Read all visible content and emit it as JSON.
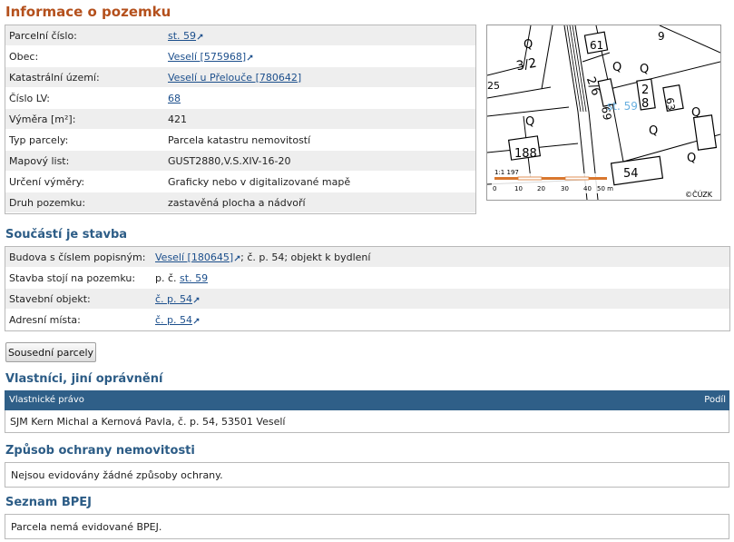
{
  "title": "Informace o pozemku",
  "parcel": [
    {
      "label": "Parcelní číslo:",
      "value": "st. 59",
      "link": true,
      "ext": true
    },
    {
      "label": "Obec:",
      "value": "Veselí [575968]",
      "link": true,
      "ext": true
    },
    {
      "label": "Katastrální území:",
      "value": "Veselí u Přelouče [780642]",
      "link": true,
      "ext": false
    },
    {
      "label": "Číslo LV:",
      "value": "68",
      "link": true,
      "ext": false
    },
    {
      "label": "Výměra [m²]:",
      "value": "421",
      "link": false,
      "ext": false
    },
    {
      "label": "Typ parcely:",
      "value": "Parcela katastru nemovitostí",
      "link": false,
      "ext": false
    },
    {
      "label": "Mapový list:",
      "value": "GUST2880,V.S.XIV-16-20",
      "link": false,
      "ext": false
    },
    {
      "label": "Určení výměry:",
      "value": "Graficky nebo v digitalizované mapě",
      "link": false,
      "ext": false
    },
    {
      "label": "Druh pozemku:",
      "value": "zastavěná plocha a nádvoří",
      "link": false,
      "ext": false
    }
  ],
  "map": {
    "parcel_label": "st. 59",
    "scale_text": "1:1 197",
    "scale_ticks": [
      "0",
      "10",
      "20",
      "30",
      "40",
      "50 m"
    ],
    "copyright": "©ČÚZK",
    "numbers": [
      "61",
      "3/2",
      "25",
      "2/6",
      "69",
      "2",
      "8",
      "63",
      "9",
      "188",
      "54"
    ]
  },
  "building": {
    "title": "Součástí je stavba",
    "row1": {
      "label": "Budova s číslem popisným:",
      "link": "Veselí [180645]",
      "suffix": "; č. p. 54; objekt k bydlení"
    },
    "row2": {
      "label": "Stavba stojí na pozemku:",
      "prefix": "p. č.",
      "link": "st. 59"
    },
    "row3": {
      "label": "Stavební objekt:",
      "link": "č. p. 54"
    },
    "row4": {
      "label": "Adresní místa:",
      "link": "č. p. 54"
    }
  },
  "neighbors_button": "Sousední parcely",
  "owners": {
    "title": "Vlastníci, jiní oprávnění",
    "col_right": "Vlastnické právo",
    "col_share": "Podíl",
    "row": "SJM Kern Michal a Kernová Pavla, č. p. 54, 53501 Veselí"
  },
  "protection": {
    "title": "Způsob ochrany nemovitosti",
    "text": "Nejsou evidovány žádné způsoby ochrany."
  },
  "bpej": {
    "title": "Seznam BPEJ",
    "text": "Parcela nemá evidované BPEJ."
  },
  "colors": {
    "heading_main": "#b4501c",
    "heading_sec": "#2c5c86",
    "table_header": "#2f5f88",
    "link": "#1c4f8c"
  }
}
